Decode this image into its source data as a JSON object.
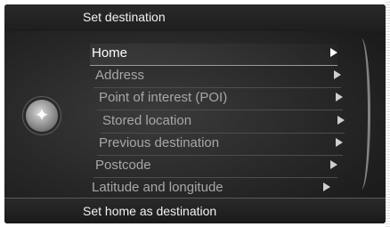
{
  "header": {
    "title": "Set destination"
  },
  "menu": {
    "items": [
      {
        "label": "Home",
        "selected": true
      },
      {
        "label": "Address",
        "selected": false
      },
      {
        "label": "Point of interest (POI)",
        "selected": false
      },
      {
        "label": "Stored location",
        "selected": false
      },
      {
        "label": "Previous destination",
        "selected": false
      },
      {
        "label": "Postcode",
        "selected": false
      },
      {
        "label": "Latitude and longitude",
        "selected": false
      }
    ]
  },
  "footer": {
    "hint": "Set home as destination"
  },
  "icons": {
    "knob": "navigation-knob-icon",
    "arrow": "chevron-right-icon"
  },
  "colors": {
    "background": "#262626",
    "selected_text": "#ffffff",
    "unselected_text": "#a7a7a7"
  }
}
